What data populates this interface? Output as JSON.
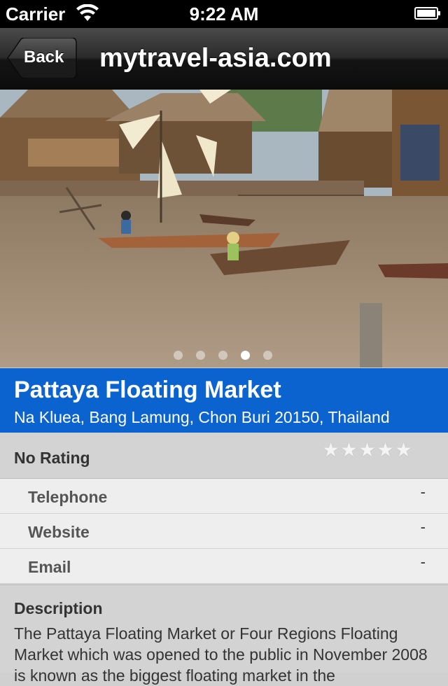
{
  "status_bar": {
    "carrier": "Carrier",
    "time": "9:22 AM"
  },
  "nav": {
    "back_label": "Back",
    "title": "mytravel-asia.com"
  },
  "gallery": {
    "page_count": 5,
    "current_page": 4
  },
  "place": {
    "name": "Pattaya Floating Market",
    "address": "Na Kluea, Bang Lamung, Chon Buri 20150, Thailand"
  },
  "rating": {
    "label": "No Rating",
    "stars_total": 5,
    "stars_filled": 0,
    "star_glyph": "★"
  },
  "info": {
    "telephone": {
      "label": "Telephone",
      "value": "-"
    },
    "website": {
      "label": "Website",
      "value": "-"
    },
    "email": {
      "label": "Email",
      "value": "-"
    }
  },
  "description": {
    "heading": "Description",
    "text": "The Pattaya Floating Market or  Four Regions Floating Market which was opened to the public in November 2008 is known as the biggest floating market in the"
  },
  "colors": {
    "banner": "#0a63cf",
    "navbar": "#1a1a1a"
  }
}
